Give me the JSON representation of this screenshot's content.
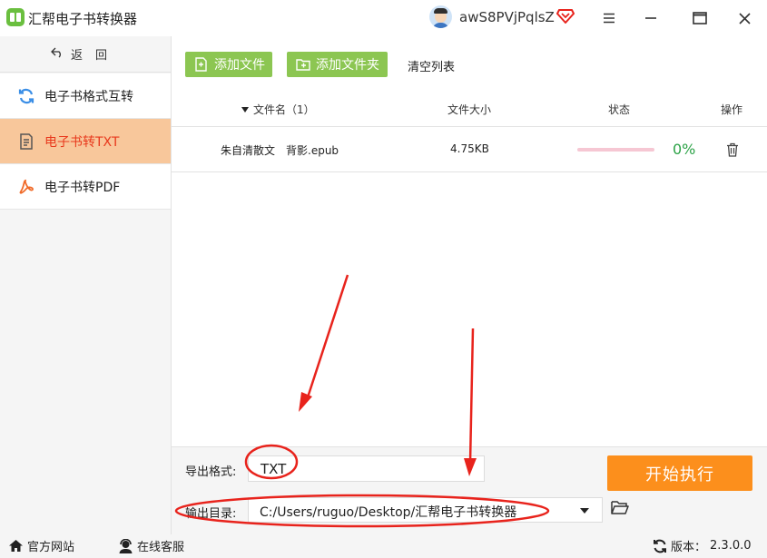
{
  "app": {
    "title": "汇帮电子书转换器",
    "username": "awS8PVjPqlsZ",
    "icons": {
      "logo": "book-logo-icon",
      "avatar": "user-avatar",
      "vip": "vip-diamond-icon"
    },
    "window_controls": [
      "menu-icon",
      "minimize-icon",
      "maximize-icon",
      "close-icon"
    ]
  },
  "sidebar": {
    "back_label": "返回",
    "items": [
      {
        "label": "电子书格式互转",
        "icon": "refresh-icon",
        "active": false
      },
      {
        "label": "电子书转TXT",
        "icon": "document-icon",
        "active": true
      },
      {
        "label": "电子书转PDF",
        "icon": "pdf-icon",
        "active": false
      }
    ]
  },
  "toolbar": {
    "add_file": "添加文件",
    "add_folder": "添加文件夹",
    "clear_list": "清空列表"
  },
  "table": {
    "headers": {
      "filename": "文件名（1）",
      "size": "文件大小",
      "status": "状态",
      "actions": "操作"
    },
    "rows": [
      {
        "filename": "朱自清散文　背影.epub",
        "size": "4.75KB",
        "progress": 0,
        "progress_label": "0%"
      }
    ]
  },
  "settings": {
    "format_label": "导出格式:",
    "format_value": "TXT",
    "dir_label": "输出目录:",
    "dir_value": "C:/Users/ruguo/Desktop/汇帮电子书转换器",
    "start_button": "开始执行"
  },
  "statusbar": {
    "website": "官方网站",
    "support": "在线客服",
    "version_label": "版本：",
    "version": "2.3.0.0"
  },
  "colors": {
    "accent_green": "#8cc652",
    "active_nav_bg": "#f8c79b",
    "active_nav_text": "#e8381c",
    "start_button": "#fc8f1c",
    "progress_text": "#2ba246",
    "annotation_red": "#e8231c"
  }
}
